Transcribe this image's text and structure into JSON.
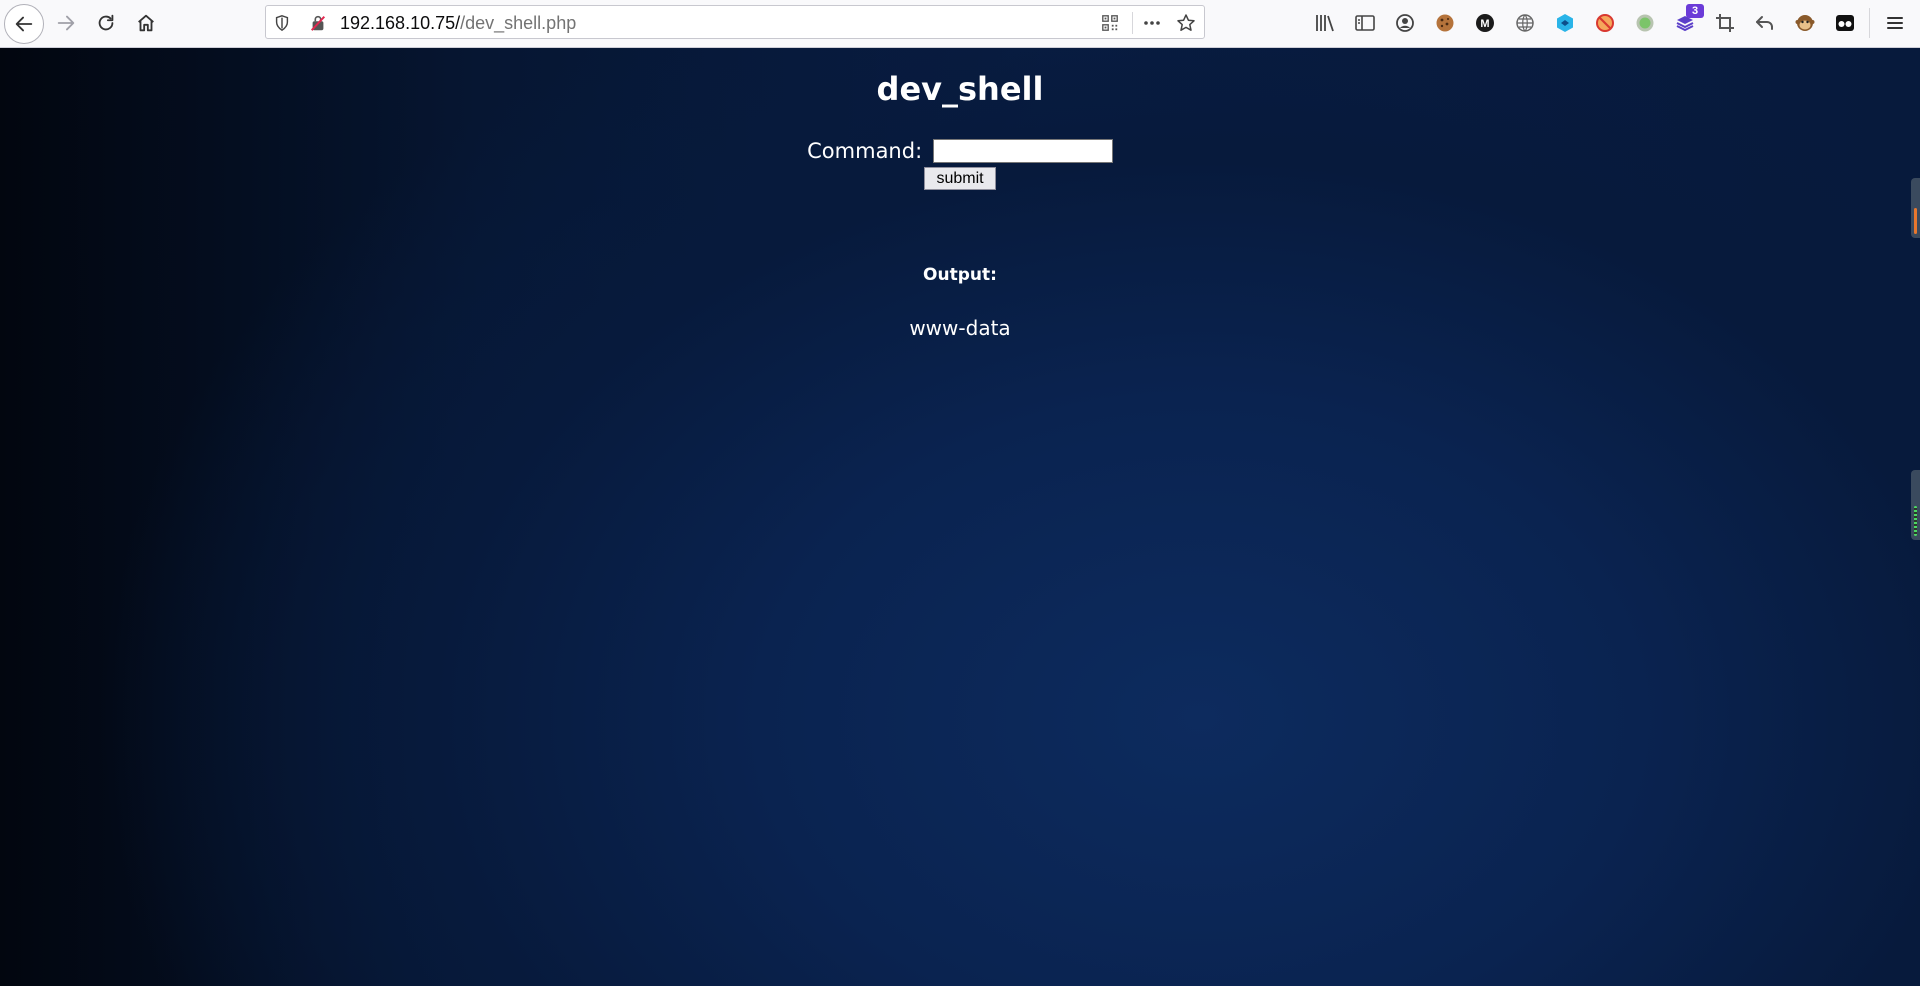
{
  "browser": {
    "url_host": "192.168.10.75/",
    "url_path": "/dev_shell.php",
    "toolbar_icons": [
      "back-icon",
      "forward-icon",
      "reload-icon",
      "home-icon",
      "library-icon",
      "sidebar-icon",
      "account-icon",
      "cookie-icon",
      "m-extension-icon",
      "globe-icon",
      "wappalyzer-icon",
      "block-icon",
      "green-circle-icon",
      "stack-extension-icon",
      "crop-icon",
      "undo-icon",
      "monkey-icon",
      "glasses-icon",
      "hamburger-menu-icon"
    ],
    "stack_badge": "3"
  },
  "page": {
    "title": "dev_shell",
    "command_label": "Command:",
    "command_value": "",
    "submit_label": "submit",
    "output_label": "Output:",
    "output_value": "www-data"
  },
  "colors": {
    "background_dark": "#02060f",
    "background_blue": "#0d2b5e",
    "text": "#ffffff"
  }
}
